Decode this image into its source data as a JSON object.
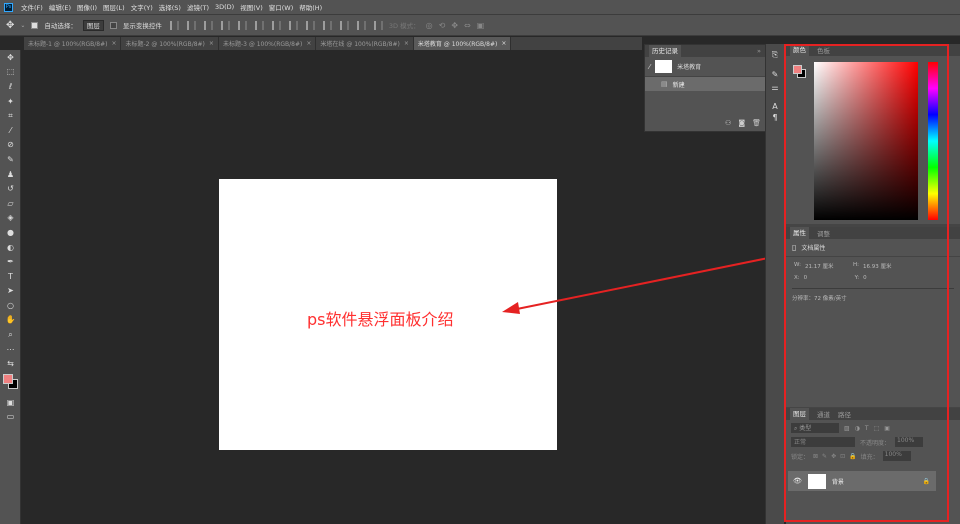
{
  "app": {
    "logo": "Ps"
  },
  "menus": [
    "文件(F)",
    "编辑(E)",
    "图像(I)",
    "图层(L)",
    "文字(Y)",
    "选择(S)",
    "滤镜(T)",
    "3D(D)",
    "视图(V)",
    "窗口(W)",
    "帮助(H)"
  ],
  "options": {
    "auto_select_label": "自动选择：",
    "auto_select_value": "图层",
    "transform_label": "显示变换控件",
    "mode_3d": "3D 模式："
  },
  "tabs": [
    {
      "label": "未标题-1 @ 100%(RGB/8#)",
      "close": "×"
    },
    {
      "label": "未标题-2 @ 100%(RGB/8#)",
      "close": "×"
    },
    {
      "label": "未标题-3 @ 100%(RGB/8#)",
      "close": "×"
    },
    {
      "label": "米塔在线 @ 100%(RGB/8#)",
      "close": "×"
    },
    {
      "label": "米塔教育 @ 100%(RGB/8#)",
      "close": "×"
    }
  ],
  "annotation": "ps软件悬浮面板介绍",
  "history": {
    "title": "历史记录",
    "snapshot": "米塔教育",
    "item": "新建",
    "collapse": "»"
  },
  "color_panel": {
    "tabs": [
      "颜色",
      "色板"
    ],
    "fg": "#f08080",
    "bg": "#000000"
  },
  "properties": {
    "tabs": [
      "属性",
      "调整"
    ],
    "section": "文档属性",
    "w_label": "W:",
    "w_value": "21.17 厘米",
    "h_label": "H:",
    "h_value": "16.93 厘米",
    "x_label": "X:",
    "x_value": "0",
    "y_label": "Y:",
    "y_value": "0",
    "resolution": "分辨率：72 像素/英寸"
  },
  "layers": {
    "tabs": [
      "图层",
      "通道",
      "路径"
    ],
    "filter": "类型",
    "blend": "正常",
    "opacity_label": "不透明度：",
    "opacity": "100%",
    "lock_label": "锁定：",
    "fill_label": "填充：",
    "fill": "100%",
    "layer_name": "背景"
  },
  "colors": {
    "accent": "#e52222",
    "canvas": "#ffffff"
  }
}
